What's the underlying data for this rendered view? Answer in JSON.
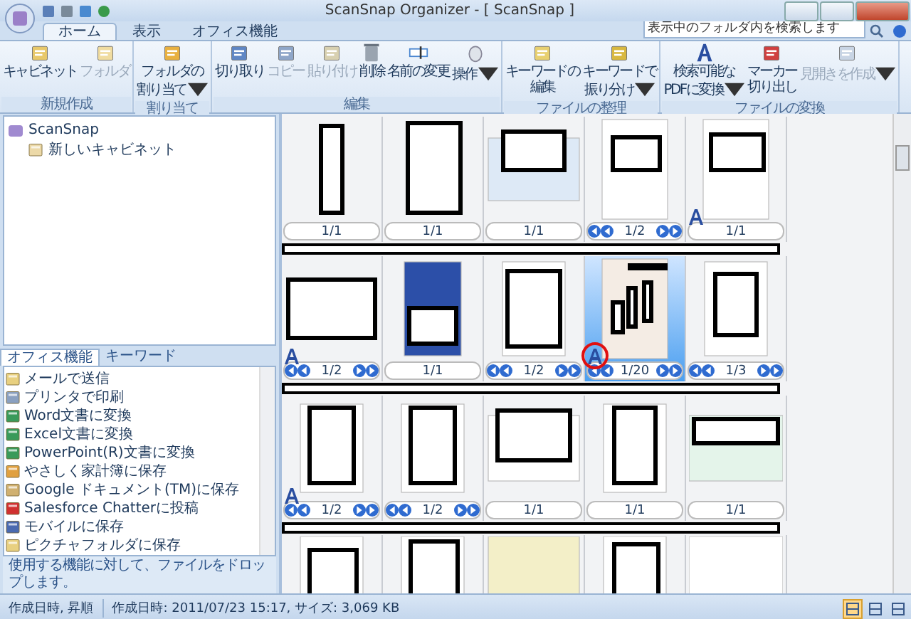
{
  "window": {
    "title": "ScanSnap Organizer - [ ScanSnap ]"
  },
  "ribbon_tabs": [
    {
      "label": "ホーム",
      "selected": true
    },
    {
      "label": "表示",
      "selected": false
    },
    {
      "label": "オフィス機能",
      "selected": false
    }
  ],
  "search": {
    "placeholder": "表示中のフォルダ内を検索します"
  },
  "ribbon_groups": [
    {
      "label": "新規作成",
      "buttons": [
        {
          "lines": [
            "キャビネット"
          ],
          "disabled": false,
          "dropdown": false
        },
        {
          "lines": [
            "フォルダ"
          ],
          "disabled": true,
          "dropdown": false
        }
      ]
    },
    {
      "label": "割り当て",
      "buttons": [
        {
          "lines": [
            "フォルダの",
            "割り当て"
          ],
          "disabled": false,
          "dropdown": true
        }
      ]
    },
    {
      "label": "編集",
      "buttons": [
        {
          "lines": [
            "切り取り"
          ],
          "disabled": false,
          "dropdown": false
        },
        {
          "lines": [
            "コピー"
          ],
          "disabled": true,
          "dropdown": false
        },
        {
          "lines": [
            "貼り付け"
          ],
          "disabled": true,
          "dropdown": false
        },
        {
          "lines": [
            "削除"
          ],
          "disabled": false,
          "dropdown": false
        },
        {
          "lines": [
            "名前の変更"
          ],
          "disabled": false,
          "dropdown": false
        },
        {
          "lines": [
            "操作"
          ],
          "disabled": false,
          "dropdown": true
        }
      ]
    },
    {
      "label": "ファイルの整理",
      "buttons": [
        {
          "lines": [
            "キーワードの",
            "編集"
          ],
          "disabled": false,
          "dropdown": false
        },
        {
          "lines": [
            "キーワードで",
            "振り分け"
          ],
          "disabled": false,
          "dropdown": true
        }
      ]
    },
    {
      "label": "ファイルの変換",
      "buttons": [
        {
          "lines": [
            "検索可能な",
            "PDFに変換"
          ],
          "disabled": false,
          "dropdown": true
        },
        {
          "lines": [
            "マーカー",
            "切り出し"
          ],
          "disabled": false,
          "dropdown": false
        },
        {
          "lines": [
            "見開きを作成"
          ],
          "disabled": true,
          "dropdown": true
        }
      ]
    }
  ],
  "tree": {
    "items": [
      {
        "label": "ScanSnap",
        "children": [
          {
            "label": "新しいキャビネット"
          }
        ]
      }
    ]
  },
  "panel_tabs": [
    {
      "label": "オフィス機能",
      "selected": true
    },
    {
      "label": "キーワード",
      "selected": false
    }
  ],
  "office_actions": [
    {
      "label": "メールで送信"
    },
    {
      "label": "プリンタで印刷"
    },
    {
      "label": "Word文書に変換"
    },
    {
      "label": "Excel文書に変換"
    },
    {
      "label": "PowerPoint(R)文書に変換"
    },
    {
      "label": "やさしく家計簿に保存"
    },
    {
      "label": "Google ドキュメント(TM)に保存"
    },
    {
      "label": "Salesforce Chatterに投稿"
    },
    {
      "label": "モバイルに保存"
    },
    {
      "label": "ピクチャフォルダに保存"
    }
  ],
  "hint": "使用する機能に対して、ファイルをドロップします。",
  "thumbnail_rows": [
    {
      "cells": [
        {
          "page": "1/1",
          "multipage": false,
          "searchable": false,
          "selected": false,
          "circled": false
        },
        {
          "page": "1/1",
          "multipage": false,
          "searchable": false,
          "selected": false,
          "circled": false
        },
        {
          "page": "1/1",
          "multipage": false,
          "searchable": false,
          "selected": false,
          "circled": false
        },
        {
          "page": "1/2",
          "multipage": true,
          "searchable": false,
          "selected": false,
          "circled": false
        },
        {
          "page": "1/1",
          "multipage": false,
          "searchable": true,
          "selected": false,
          "circled": false
        }
      ]
    },
    {
      "cells": [
        {
          "page": "1/2",
          "multipage": true,
          "searchable": true,
          "selected": false,
          "circled": false
        },
        {
          "page": "1/1",
          "multipage": false,
          "searchable": false,
          "selected": false,
          "circled": false
        },
        {
          "page": "1/2",
          "multipage": true,
          "searchable": false,
          "selected": false,
          "circled": false
        },
        {
          "page": "1/20",
          "multipage": true,
          "searchable": true,
          "selected": true,
          "circled": true
        },
        {
          "page": "1/3",
          "multipage": true,
          "searchable": false,
          "selected": false,
          "circled": false
        }
      ]
    },
    {
      "cells": [
        {
          "page": "1/2",
          "multipage": true,
          "searchable": true,
          "selected": false,
          "circled": false
        },
        {
          "page": "1/2",
          "multipage": true,
          "searchable": false,
          "selected": false,
          "circled": false
        },
        {
          "page": "1/1",
          "multipage": false,
          "searchable": false,
          "selected": false,
          "circled": false
        },
        {
          "page": "1/1",
          "multipage": false,
          "searchable": false,
          "selected": false,
          "circled": false
        },
        {
          "page": "1/1",
          "multipage": false,
          "searchable": false,
          "selected": false,
          "circled": false
        }
      ]
    },
    {
      "cells": [
        {
          "selected": false
        },
        {
          "selected": false
        },
        {
          "selected": false
        },
        {
          "selected": false
        },
        {
          "selected": false
        }
      ]
    }
  ],
  "view_modes": [
    {
      "selected": true
    },
    {
      "selected": false
    },
    {
      "selected": false
    }
  ],
  "status_bar": {
    "sort": "作成日時, 昇順",
    "info": "作成日時: 2011/07/23 15:17, サイズ: 3,069 KB"
  }
}
